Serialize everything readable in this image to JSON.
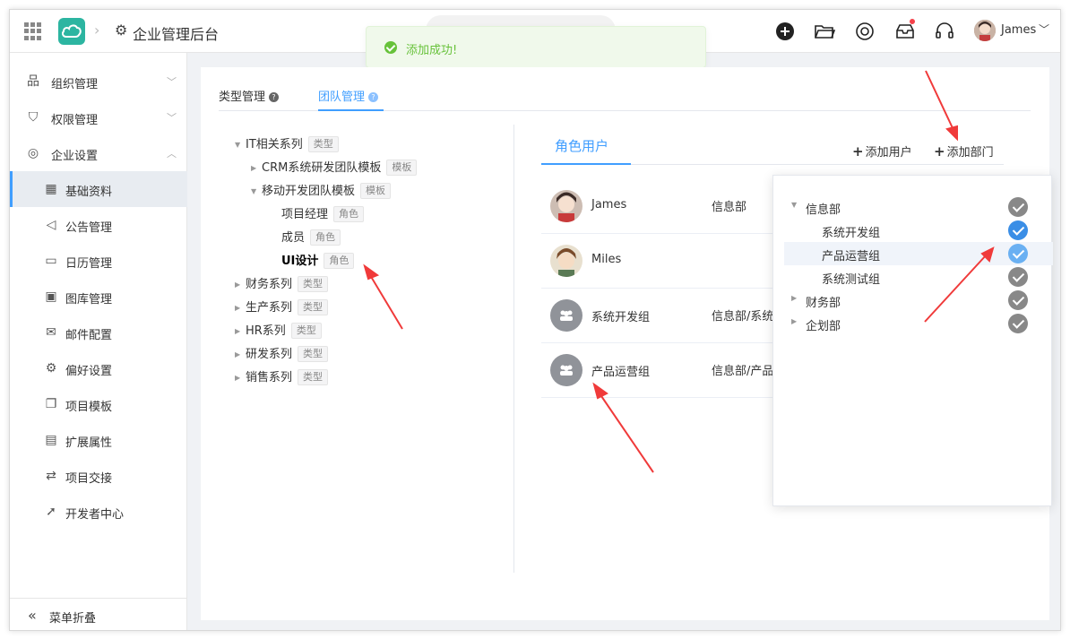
{
  "header": {
    "app_title": "企业管理后台",
    "user_name": "James",
    "search_placeholder": ""
  },
  "toast": {
    "message": "添加成功!"
  },
  "sidebar": {
    "items": [
      {
        "label": "组织管理",
        "icon": "org-icon"
      },
      {
        "label": "权限管理",
        "icon": "shield-icon"
      },
      {
        "label": "企业设置",
        "icon": "globe-icon"
      }
    ],
    "sub_items": [
      {
        "label": "基础资料",
        "icon": "grid-icon"
      },
      {
        "label": "公告管理",
        "icon": "megaphone-icon"
      },
      {
        "label": "日历管理",
        "icon": "calendar-icon"
      },
      {
        "label": "图库管理",
        "icon": "image-icon"
      },
      {
        "label": "邮件配置",
        "icon": "mail-icon"
      },
      {
        "label": "偏好设置",
        "icon": "gear-icon"
      },
      {
        "label": "项目模板",
        "icon": "copy-icon"
      },
      {
        "label": "扩展属性",
        "icon": "document-icon"
      },
      {
        "label": "项目交接",
        "icon": "swap-icon"
      },
      {
        "label": "开发者中心",
        "icon": "rocket-icon"
      }
    ],
    "collapse_label": "菜单折叠"
  },
  "tabs": {
    "type_mgmt": "类型管理",
    "team_mgmt": "团队管理"
  },
  "tree": {
    "tags": {
      "type": "类型",
      "template": "模板",
      "role": "角色"
    },
    "nodes": [
      {
        "label": "IT相关系列"
      },
      {
        "label": "CRM系统研发团队模板"
      },
      {
        "label": "移动开发团队模板"
      },
      {
        "label": "项目经理"
      },
      {
        "label": "成员"
      },
      {
        "label": "UI设计"
      },
      {
        "label": "财务系列"
      },
      {
        "label": "生产系列"
      },
      {
        "label": "HR系列"
      },
      {
        "label": "研发系列"
      },
      {
        "label": "销售系列"
      }
    ]
  },
  "right_panel": {
    "tab_label": "角色用户",
    "add_user": "添加用户",
    "add_dept": "添加部门",
    "rows": [
      {
        "name": "James",
        "dept": "信息部"
      },
      {
        "name": "Miles",
        "dept": ""
      },
      {
        "name": "系统开发组",
        "dept": "信息部/系统"
      },
      {
        "name": "产品运营组",
        "dept": "信息部/产品"
      }
    ]
  },
  "dept_dropdown": {
    "items": [
      {
        "label": "信息部"
      },
      {
        "label": "系统开发组"
      },
      {
        "label": "产品运营组"
      },
      {
        "label": "系统测试组"
      },
      {
        "label": "财务部"
      },
      {
        "label": "企划部"
      }
    ]
  },
  "colors": {
    "accent": "#409eff",
    "success": "#67c23a",
    "annotation": "#f03a3a"
  }
}
